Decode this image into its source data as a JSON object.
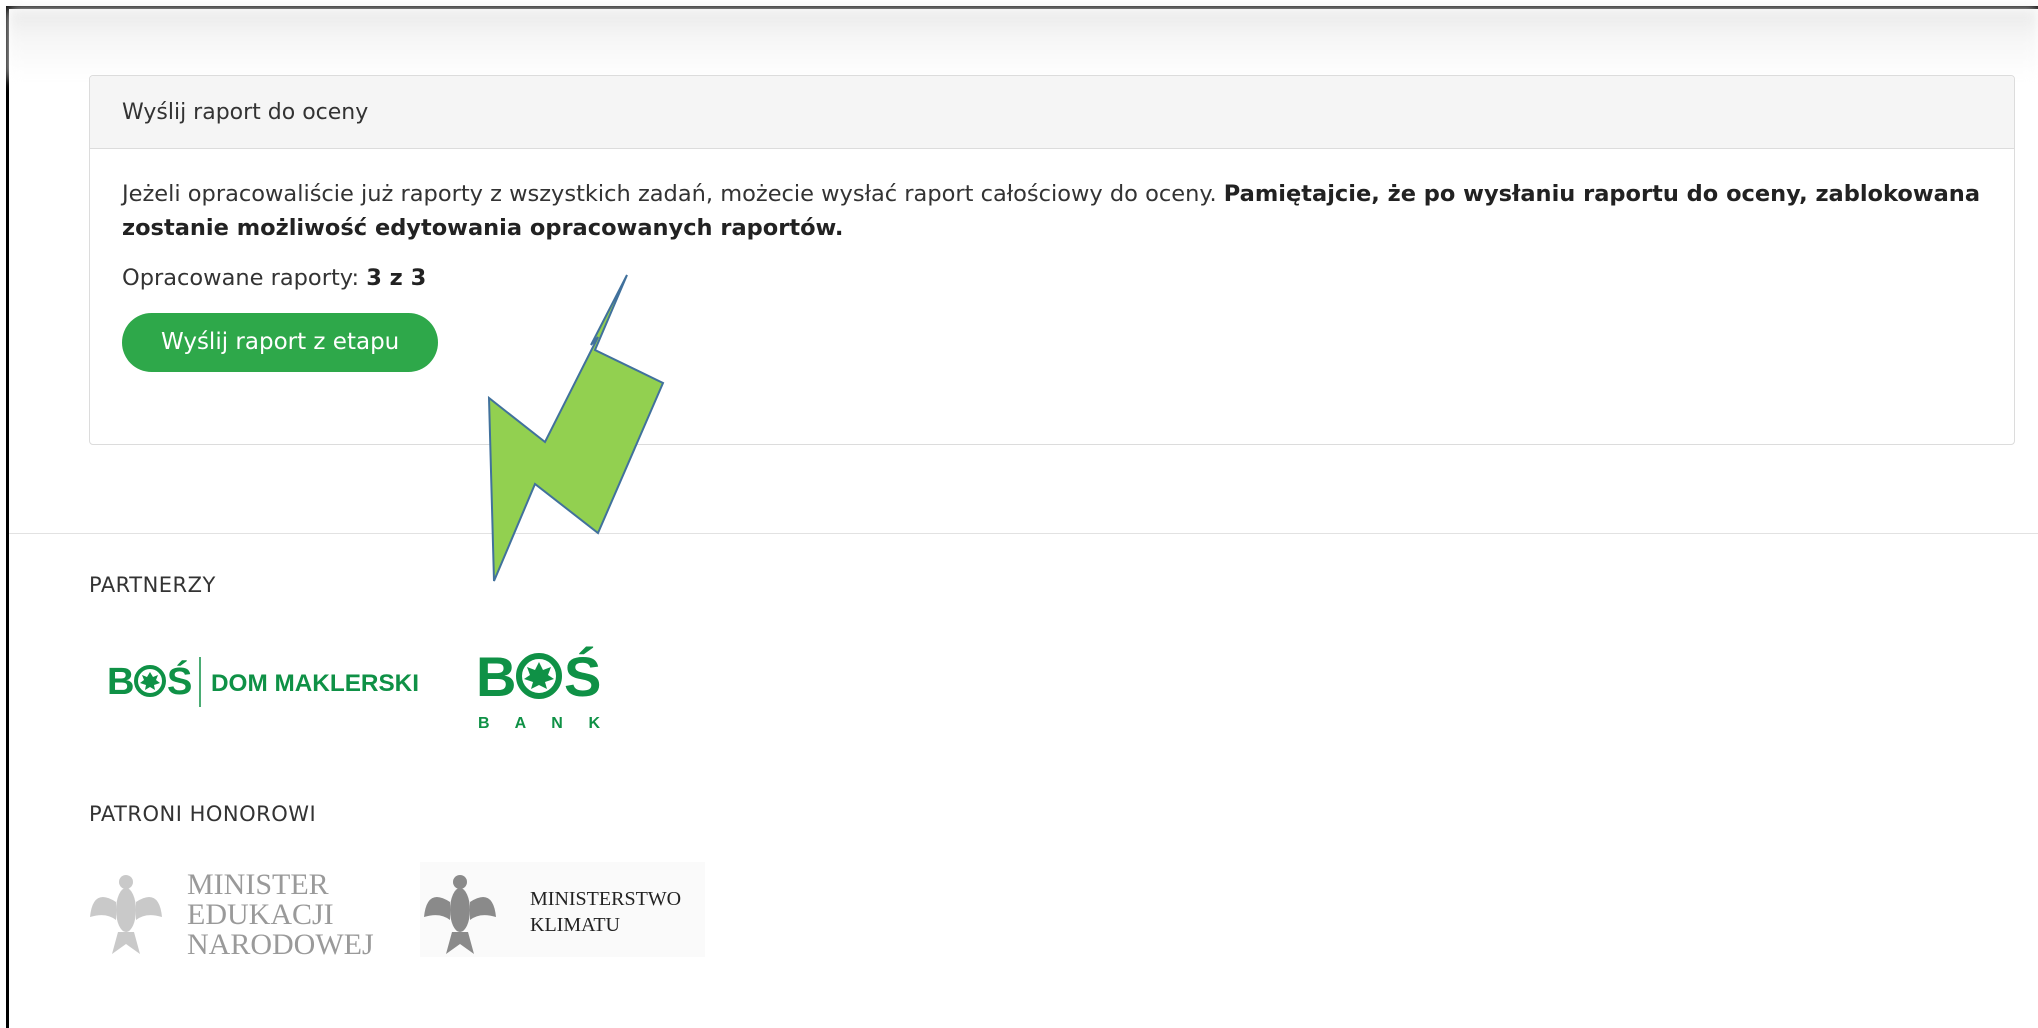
{
  "panel": {
    "title": "Wyślij raport do oceny",
    "description": "Jeżeli opracowaliście już raporty z wszystkich zadań, możecie wysłać raport całościowy do oceny.",
    "warning": "Pamiętajcie, że po wysłaniu raportu do oceny, zablokowana zostanie możliwość edytowania opracowanych raportów.",
    "progress_label": "Opracowane raporty:",
    "progress_value": "3 z 3",
    "send_button": "Wyślij raport z etapu"
  },
  "footer": {
    "partners_label": "PARTNERZY",
    "patrons_label": "PATRONI HONOROWI",
    "partner_logos": [
      {
        "brand": "BOŚ",
        "sub": "DOM MAKLERSKI"
      },
      {
        "brand": "BOŚ",
        "sub": "BANK"
      }
    ],
    "patron_logos": [
      {
        "line1": "MINISTER",
        "line2": "EDUKACJI",
        "line3": "NARODOWEJ"
      },
      {
        "line1": "MINISTERSTWO",
        "line2": "KLIMATU"
      }
    ]
  },
  "colors": {
    "button_green": "#2ea84a",
    "bos_green": "#0f9146",
    "arrow_fill": "#92d050",
    "arrow_stroke": "#41719c"
  }
}
